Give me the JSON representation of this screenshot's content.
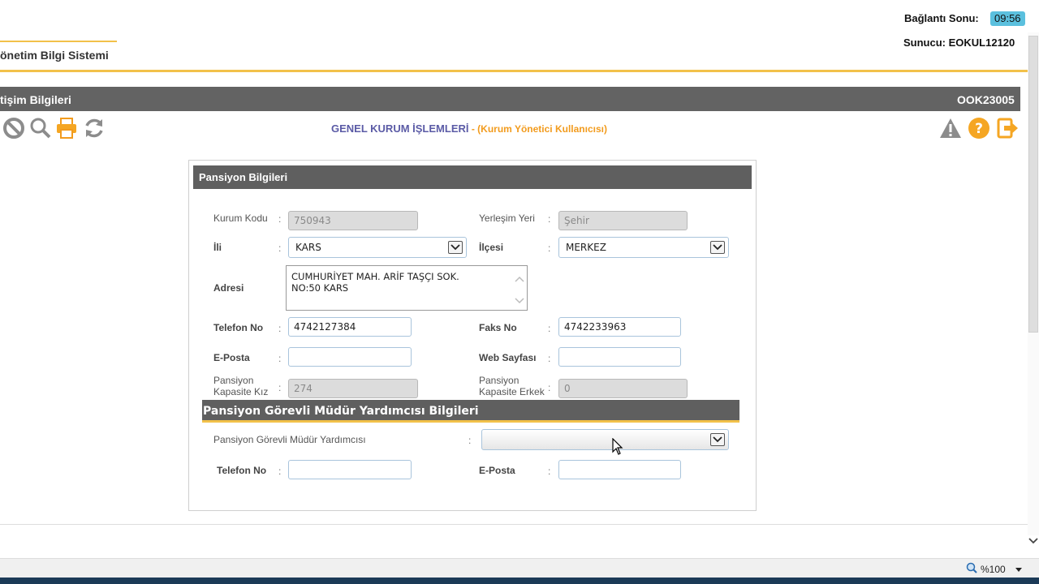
{
  "header": {
    "app_name": "önetim Bilgi Sistemi",
    "connection_label": "Bağlantı Sonu:",
    "connection_time": "09:56",
    "server_label": "Sunucu: EOKUL12120"
  },
  "title_bar": {
    "left": "tişim Bilgileri",
    "right": "OOK23005"
  },
  "toolbar": {
    "operations_title": "GENEL KURUM İŞLEMLERİ",
    "operations_sep": " - ",
    "operations_subtitle": "(Kurum Yönetici Kullanıcısı)",
    "icons": [
      "cancel-icon",
      "search-icon",
      "print-icon",
      "refresh-icon",
      "warning-icon",
      "help-icon",
      "exit-icon"
    ]
  },
  "panel": {
    "title": "Pansiyon Bilgileri",
    "kurum_kodu": {
      "label": "Kurum Kodu",
      "value": "750943"
    },
    "yerlesim_yeri": {
      "label": "Yerleşim Yeri",
      "value": "Şehir"
    },
    "il": {
      "label": "İli",
      "value": "KARS"
    },
    "ilce": {
      "label": "İlçesi",
      "value": "MERKEZ"
    },
    "adres": {
      "label": "Adresi",
      "value": "CUMHURİYET MAH. ARİF TAŞÇI SOK. NO:50 KARS"
    },
    "telefon": {
      "label": "Telefon No",
      "value": "4742127384"
    },
    "faks": {
      "label": "Faks No",
      "value": "4742233963"
    },
    "eposta": {
      "label": "E-Posta",
      "value": ""
    },
    "web": {
      "label": "Web Sayfası",
      "value": ""
    },
    "kapasite_kiz": {
      "label_line1": "Pansiyon",
      "label_line2": "Kapasite Kız",
      "value": "274"
    },
    "kapasite_erkek": {
      "label_line1": "Pansiyon",
      "label_line2": "Kapasite Erkek",
      "value": "0"
    },
    "colon": ":"
  },
  "section2": {
    "title": "Pansiyon Görevli Müdür Yardımcısı Bilgileri",
    "mudur": {
      "label": "Pansiyon Görevli Müdür Yardımcısı",
      "value": ""
    },
    "telefon": {
      "label": "Telefon No",
      "value": ""
    },
    "eposta": {
      "label": "E-Posta",
      "value": ""
    }
  },
  "status": {
    "zoom": "%100"
  },
  "colors": {
    "accent_gold": "#f2c14a",
    "title_gray": "#636363",
    "ops_purple": "#5b5ba6",
    "ops_orange": "#f29b1d",
    "time_badge": "#5bc0de"
  }
}
